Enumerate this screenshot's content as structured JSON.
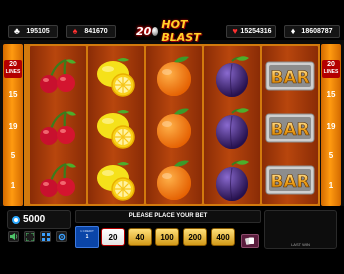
{
  "jackpots": {
    "clubs": {
      "icon": "club-icon",
      "value": "195105"
    },
    "spades": {
      "icon": "spade-icon",
      "value": "841670"
    },
    "hearts": {
      "icon": "heart-icon",
      "value": "15254316"
    },
    "diamonds": {
      "icon": "diamond-icon",
      "value": "18608787"
    }
  },
  "logo": {
    "number": "20",
    "text": "HOT BLAST"
  },
  "lines": {
    "badge_number": "20",
    "badge_text": "LINES",
    "left_numbers": [
      "15",
      "19",
      "5",
      "1"
    ],
    "right_numbers": [
      "15",
      "19",
      "5",
      "1"
    ]
  },
  "reels": [
    [
      "cherry",
      "cherry",
      "cherry"
    ],
    [
      "lemon",
      "lemon",
      "lemon"
    ],
    [
      "orange",
      "orange",
      "orange"
    ],
    [
      "plum",
      "plum",
      "plum"
    ],
    [
      "bar",
      "bar",
      "bar"
    ]
  ],
  "symbols": {
    "bar_text": "BAR"
  },
  "bottom": {
    "balance": "5000",
    "message": "PLEASE PLACE YOUR BET",
    "last_win_label": "LAST WIN",
    "credit_label": "1 CREDIT",
    "credit_value": "1",
    "bets": [
      "20",
      "40",
      "100",
      "200",
      "400"
    ],
    "selected_bet": "20"
  },
  "colors": {
    "accent_orange": "#ff9a10",
    "reel_bg": "#b8460d",
    "badge_red": "#b40000",
    "credit_blue": "#0a45a8"
  }
}
